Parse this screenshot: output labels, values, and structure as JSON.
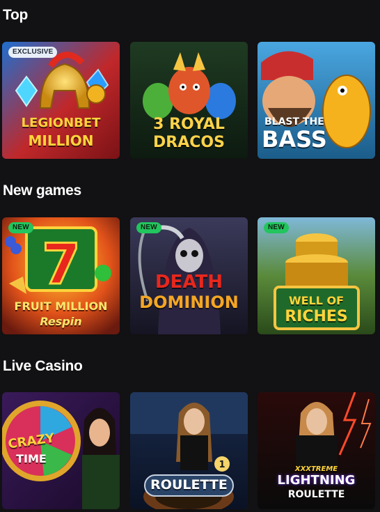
{
  "sections": [
    {
      "title": "Top",
      "tiles": [
        {
          "name": "LegionBet Million",
          "art_line1": "LEGIONBET",
          "art_line2": "MILLION",
          "badge": "EXCLUSIVE"
        },
        {
          "name": "3 Royal Dracos",
          "art_line1": "3 ROYAL",
          "art_line2": "DRACOS",
          "badge": ""
        },
        {
          "name": "Blast the Bass",
          "art_line1": "BLAST THE",
          "art_line2": "BASS",
          "badge": ""
        }
      ]
    },
    {
      "title": "New games",
      "tiles": [
        {
          "name": "Fruit Million Respin",
          "art_line1": "FRUIT MILLION",
          "art_line2": "Respin",
          "badge": "NEW"
        },
        {
          "name": "Death Dominion",
          "art_line1": "DEATH",
          "art_line2": "DOMINION",
          "badge": "NEW"
        },
        {
          "name": "Well of Riches",
          "art_line1": "WELL OF",
          "art_line2": "RICHES",
          "badge": "NEW"
        }
      ]
    },
    {
      "title": "Live Casino",
      "tiles": [
        {
          "name": "Crazy Time",
          "art_line1": "CRAZY",
          "art_line2": "TIME",
          "badge": ""
        },
        {
          "name": "Roulette",
          "art_line1": "ROULETTE",
          "art_line2": "",
          "badge": ""
        },
        {
          "name": "XXXtreme Lightning Roulette",
          "art_line1": "XXXTREME",
          "art_line2": "LIGHTNING",
          "art_line3": "ROULETTE",
          "badge": ""
        }
      ]
    }
  ],
  "colors": {
    "background": "#121113",
    "badge_new": "#22c55e",
    "badge_exclusive": "#e8eef7"
  }
}
